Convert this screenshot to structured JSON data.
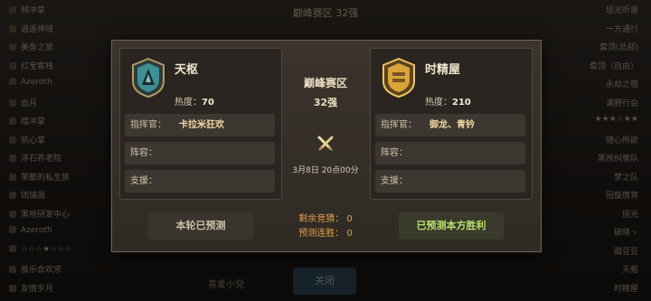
{
  "background": {
    "top_title": "巅峰赛区  32强",
    "left_list": [
      "频冲掌",
      "逍遥神域",
      "美鱼之旅",
      "红宝客栈",
      "Azeroth",
      "血月",
      "暗冲掌",
      "凯心掌",
      "浮石养老院",
      "荣都的私生族",
      "琉璃阁",
      "黑袍研发中心",
      "Azeroth",
      "☆☆☆★☆☆☆",
      "极乐合欢宗",
      "友情岁月"
    ],
    "right_list": [
      "瑶光听雷",
      "一方通行",
      "套顶(总部)",
      "套顶（自由）",
      "永劫之宿",
      "满野行会",
      "★★★☆★★",
      "随心所欲",
      "黑袍纠察队",
      "梦之队",
      "回旋唐宵",
      "瑶光",
      "破晓ヽ",
      "甜豆豆",
      "天枢",
      "时精屋"
    ],
    "bottom_button": "关闭",
    "bottom_text": "喜爱小党"
  },
  "modal": {
    "center_title": "巅峰赛区",
    "center_sub": "32强",
    "match_time": "3月8日 20点00分",
    "left_team": {
      "name": "天枢",
      "heat_label": "热度：",
      "heat_value": "70",
      "commander_label": "指挥官：",
      "commander_value": "卡拉米狂欢",
      "lineup_label": "阵容：",
      "lineup_value": "",
      "support_label": "支援：",
      "support_value": "",
      "emblem_color": "#3e8f94"
    },
    "right_team": {
      "name": "时精屋",
      "heat_label": "热度：",
      "heat_value": "210",
      "commander_label": "指挥官：",
      "commander_value": "御龙、青钤",
      "lineup_label": "阵容：",
      "lineup_value": "",
      "support_label": "支援：",
      "support_value": "",
      "emblem_color": "#d9a43a"
    },
    "predicted_button": "本轮已预测",
    "win_button": "已预测本方胜利",
    "remaining_guess": "剩余竞猜：  0",
    "prediction_streak": "预测连胜：  0"
  },
  "colors": {
    "accent_orange": "#e0a050",
    "accent_green": "#b7e06a",
    "gold_text": "#f0d9a4"
  }
}
